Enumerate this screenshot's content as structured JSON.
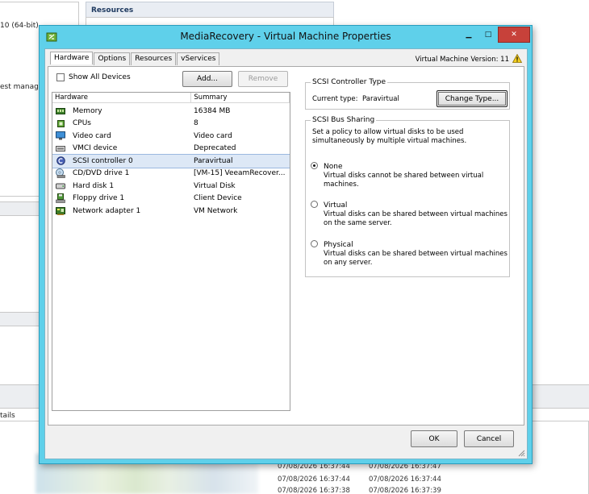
{
  "background": {
    "left_fragments": [
      "10 (64-bit)",
      "est manage",
      "tails"
    ],
    "resources_header": "Resources",
    "event_rows": [
      [
        "07/08/2026 16:37:44",
        "07/08/2026 16:37:47"
      ],
      [
        "07/08/2026 16:37:44",
        "07/08/2026 16:37:44"
      ],
      [
        "07/08/2026 16:37:38",
        "07/08/2026 16:37:39"
      ]
    ]
  },
  "dialog": {
    "title": "MediaRecovery - Virtual Machine Properties",
    "window_controls": {
      "minimize": "▁",
      "maximize": "□",
      "close": "✕"
    },
    "tabs": [
      "Hardware",
      "Options",
      "Resources",
      "vServices"
    ],
    "vm_version": "Virtual Machine Version: 11",
    "show_all_devices": "Show All Devices",
    "add_button": "Add...",
    "remove_button": "Remove",
    "table": {
      "columns": [
        "Hardware",
        "Summary"
      ],
      "rows": [
        {
          "icon": "memory-icon",
          "name": "Memory",
          "summary": "16384 MB",
          "selected": false
        },
        {
          "icon": "cpu-icon",
          "name": "CPUs",
          "summary": "8",
          "selected": false
        },
        {
          "icon": "monitor-icon",
          "name": "Video card",
          "summary": "Video card",
          "selected": false
        },
        {
          "icon": "device-icon",
          "name": "VMCI device",
          "summary": "Deprecated",
          "selected": false
        },
        {
          "icon": "scsi-icon",
          "name": "SCSI controller 0",
          "summary": "Paravirtual",
          "selected": true
        },
        {
          "icon": "cd-dvd-icon",
          "name": "CD/DVD drive 1",
          "summary": "[VM-15] VeeamRecover...",
          "selected": false
        },
        {
          "icon": "hard-disk-icon",
          "name": "Hard disk 1",
          "summary": "Virtual Disk",
          "selected": false
        },
        {
          "icon": "floppy-icon",
          "name": "Floppy drive 1",
          "summary": "Client Device",
          "selected": false
        },
        {
          "icon": "network-adapter-icon",
          "name": "Network adapter 1",
          "summary": "VM Network",
          "selected": false
        }
      ]
    },
    "scsi_type": {
      "group_title": "SCSI Controller Type",
      "current_label": "Current type:",
      "current_value": "Paravirtual",
      "change_button": "Change Type..."
    },
    "bus_sharing": {
      "group_title": "SCSI Bus Sharing",
      "intro_line1": "Set a policy to allow virtual disks to be used",
      "intro_line2": "simultaneously by multiple virtual machines.",
      "options": [
        {
          "label": "None",
          "desc1": "Virtual disks cannot be shared between virtual",
          "desc2": "machines.",
          "checked": true
        },
        {
          "label": "Virtual",
          "desc1": "Virtual disks can be shared between virtual machines",
          "desc2": "on the same server.",
          "checked": false
        },
        {
          "label": "Physical",
          "desc1": "Virtual disks can be shared between virtual machines",
          "desc2": "on any server.",
          "checked": false
        }
      ]
    },
    "ok_button": "OK",
    "cancel_button": "Cancel"
  }
}
